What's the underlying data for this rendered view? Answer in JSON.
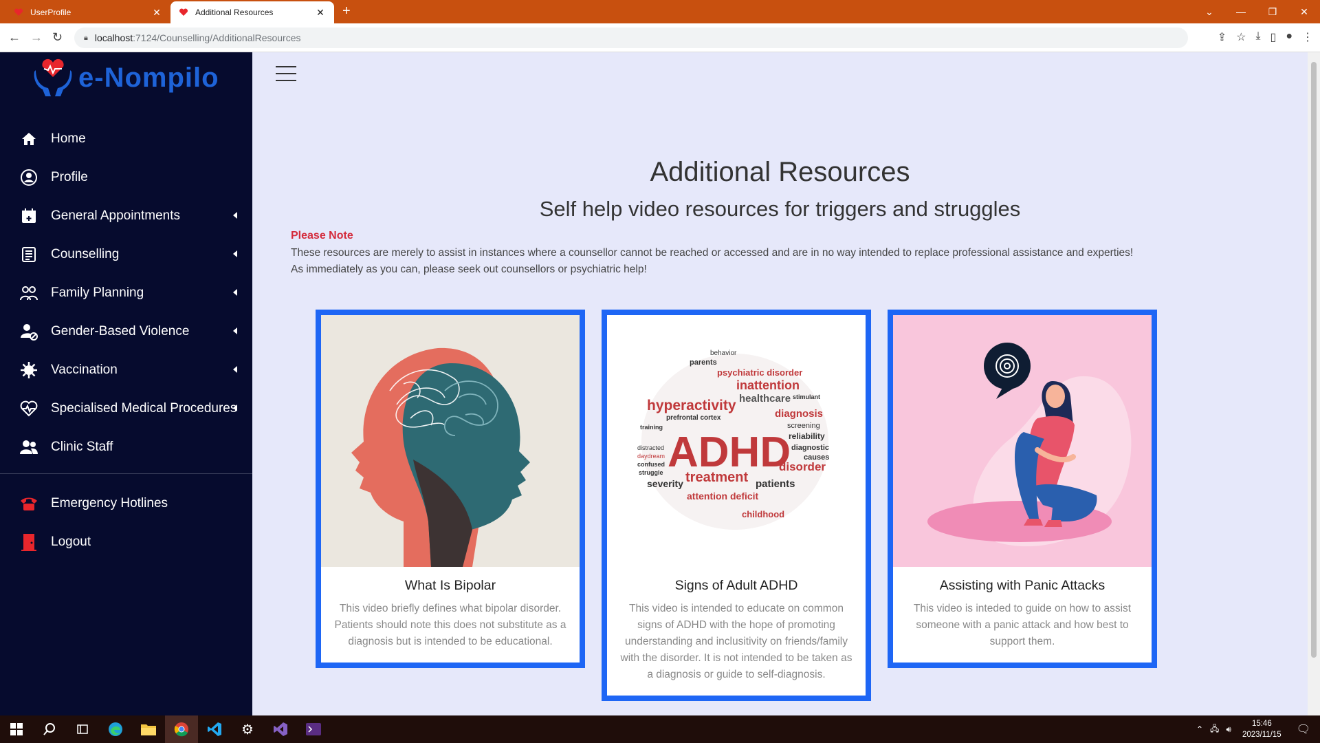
{
  "browser": {
    "tabs": [
      {
        "title": "UserProfile",
        "active": false
      },
      {
        "title": "Additional Resources",
        "active": true
      }
    ],
    "url_host": "localhost",
    "url_path": ":7124/Counselling/AdditionalResources"
  },
  "brand": {
    "name": "e-Nompilo",
    "accent": "#1e63d8",
    "heart": "#e8262c"
  },
  "sidebar": {
    "items": [
      {
        "label": "Home",
        "icon": "home-icon",
        "has_caret": false
      },
      {
        "label": "Profile",
        "icon": "user-circle-icon",
        "has_caret": false
      },
      {
        "label": "General Appointments",
        "icon": "calendar-plus-icon",
        "has_caret": true
      },
      {
        "label": "Counselling",
        "icon": "clipboard-list-icon",
        "has_caret": true
      },
      {
        "label": "Family Planning",
        "icon": "family-icon",
        "has_caret": true
      },
      {
        "label": "Gender-Based Violence",
        "icon": "user-block-icon",
        "has_caret": true
      },
      {
        "label": "Vaccination",
        "icon": "virus-icon",
        "has_caret": true
      },
      {
        "label": "Specialised Medical Procedures",
        "icon": "heartbeat-icon",
        "has_caret": true
      },
      {
        "label": "Clinic Staff",
        "icon": "users-icon",
        "has_caret": false
      }
    ],
    "bottom_items": [
      {
        "label": "Emergency Hotlines",
        "icon": "phone-icon"
      },
      {
        "label": "Logout",
        "icon": "door-icon"
      }
    ]
  },
  "main": {
    "title": "Additional Resources",
    "subtitle": "Self help video resources for triggers and struggles",
    "note_label": "Please Note",
    "note_line1": "These resources are merely to assist in instances where a counsellor cannot be reached or accessed and are in no way intended to replace professional assistance and experties!",
    "note_line2": "As immediately as you can, please seek out counsellors or psychiatric help!",
    "cards": [
      {
        "title": "What Is Bipolar",
        "text": "This video briefly defines what bipolar disorder. Patients should note this does not substitute as a diagnosis but is intended to be educational."
      },
      {
        "title": "Signs of Adult ADHD",
        "text": "This video is intended to educate on common signs of ADHD with the hope of promoting understanding and inclusitivity on friends/family with the disorder. It is not intended to be taken as a diagnosis or guide to self-diagnosis."
      },
      {
        "title": "Assisting with Panic Attacks",
        "text": "This video is inteded to guide on how to assist someone with a panic attack and how best to support them."
      }
    ]
  },
  "adhd_cloud": {
    "big": "ADHD",
    "words": [
      "behavior",
      "parents",
      "psychiatric disorder",
      "inattention",
      "healthcare",
      "hyperactivity",
      "diagnosis",
      "prefrontal cortex",
      "screening",
      "reliability",
      "diagnostic",
      "causes",
      "disorder",
      "treatment",
      "patients",
      "severity",
      "attention deficit",
      "childhood",
      "training",
      "distracted",
      "daydream",
      "confused",
      "struggle",
      "stimulant"
    ]
  },
  "taskbar": {
    "time": "15:46",
    "date": "2023/11/15"
  }
}
